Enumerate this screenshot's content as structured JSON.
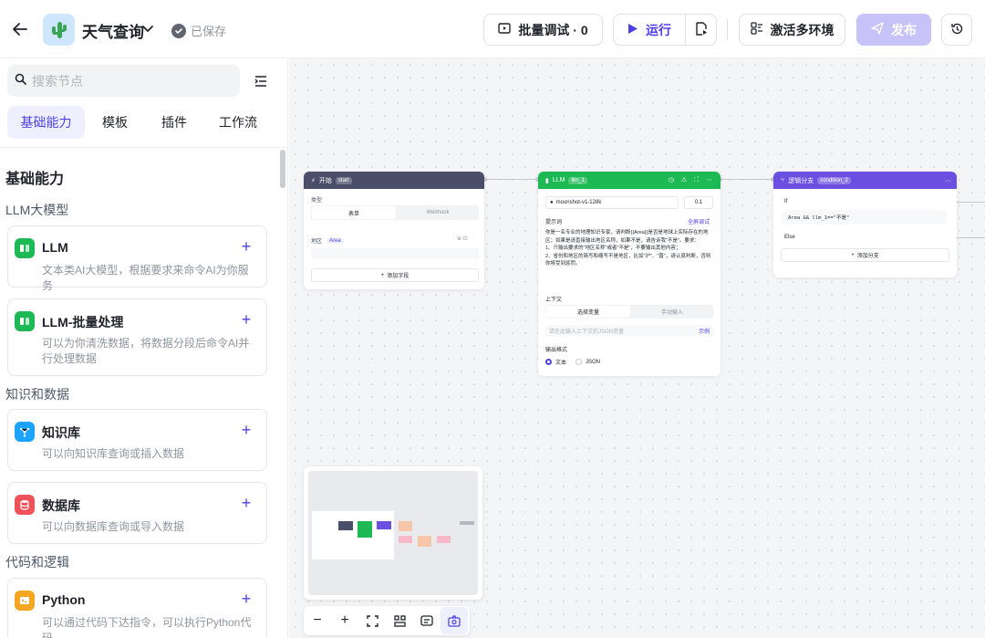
{
  "header": {
    "app_title": "天气查询",
    "saved_text": "已保存",
    "batch_label": "批量调试 · 0",
    "run_label": "运行",
    "env_label": "激活多环境",
    "publish_label": "发布"
  },
  "sidebar": {
    "search_placeholder": "搜索节点",
    "tabs": [
      "基础能力",
      "模板",
      "插件",
      "工作流"
    ],
    "section_title": "基础能力",
    "groups": [
      {
        "title": "LLM大模型"
      },
      {
        "title": "知识和数据"
      },
      {
        "title": "代码和逻辑"
      }
    ],
    "nodes": [
      {
        "name": "LLM",
        "desc": "文本类AI大模型，根据要求来命令AI为你服务"
      },
      {
        "name": "LLM-批量处理",
        "desc": "可以为你清洗数据，将数据分段后命令AI并行处理数据"
      },
      {
        "name": "知识库",
        "desc": "可以向知识库查询或插入数据"
      },
      {
        "name": "数据库",
        "desc": "可以向数据库查询或导入数据"
      },
      {
        "name": "Python",
        "desc": "可以通过代码下达指令，可以执行Python代码"
      }
    ]
  },
  "canvas": {
    "start_node": {
      "title": "开始",
      "tag": "start",
      "type_label": "类型",
      "mode_form": "表单",
      "mode_webhook": "Webhook",
      "field_label": "地区",
      "field_tag": "Area",
      "add_field": "添加字段"
    },
    "llm_node": {
      "title": "LLM",
      "tag": "llm_1",
      "model": "moonshot-v1-128k",
      "temperature": "0.1",
      "prompt_label": "提示词",
      "prompt_debug": "全屏调试",
      "prompt_text": "你是一名专业的地理知识专家，请判断{{Area}}是否是地球上实际存在的地区；如果是请直接输出地区名称，如果不是，请告诉我\"不是\"。要求：\n1、只输出要求的\"地区名称\"或者\"不是\"，不要输出其他内容；\n2、省份和地区的简写和缩写不是地区，比如\"沪\"、\"晋\"，请认真判断，否则你将受到惩罚。",
      "context_label": "上下文",
      "context_tab_var": "选择变量",
      "context_tab_manual": "手动输入",
      "context_placeholder": "请在此输入上下文的JSON变量",
      "context_link": "示例",
      "output_label": "输出格式",
      "output_text": "文本",
      "output_json": "JSON"
    },
    "cond_node": {
      "title": "逻辑分支",
      "tag": "condition_2",
      "if_label": "If",
      "expr": "Area && llm_1==\"不是\"",
      "else_label": "Else",
      "add_branch": "添加分支"
    }
  },
  "colors": {
    "accent": "#4e40e5",
    "start_head": "#4a4e69",
    "llm_head": "#1db954",
    "cond_head": "#6a4fe0",
    "kb_icon": "#1aa3ff",
    "db_icon": "#f0525a",
    "py_icon": "#f5a623",
    "llm_icon": "#1db954"
  }
}
